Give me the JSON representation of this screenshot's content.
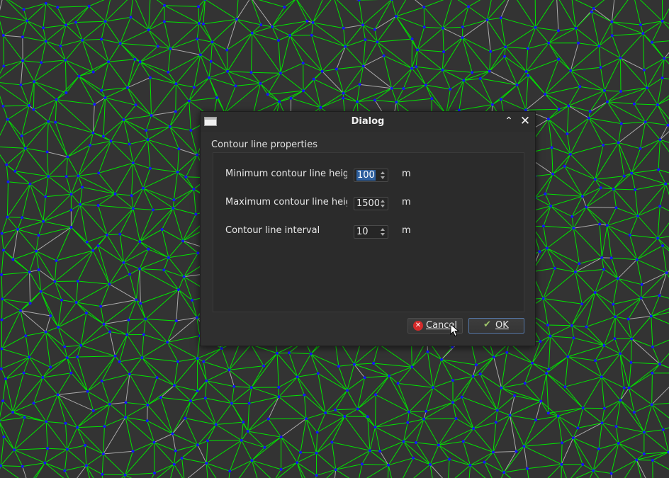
{
  "window": {
    "title": "Dialog",
    "shade_icon": "chevron-up-icon",
    "close_icon": "close-icon"
  },
  "group": {
    "title": "Contour line properties"
  },
  "fields": [
    {
      "label": "Minimum contour line height",
      "value": "100",
      "unit": "m",
      "selected": true
    },
    {
      "label": "Maximum contour line height",
      "value": "1500",
      "unit": "m",
      "selected": false
    },
    {
      "label": "Contour line interval",
      "value": "10",
      "unit": "m",
      "selected": false
    }
  ],
  "buttons": {
    "cancel": "Cancel",
    "ok": "OK"
  },
  "colors": {
    "mesh_edges": "#00e600",
    "mesh_vertices": "#1414ff",
    "background": "#333333",
    "faint_edges": "#aaaaaa"
  }
}
